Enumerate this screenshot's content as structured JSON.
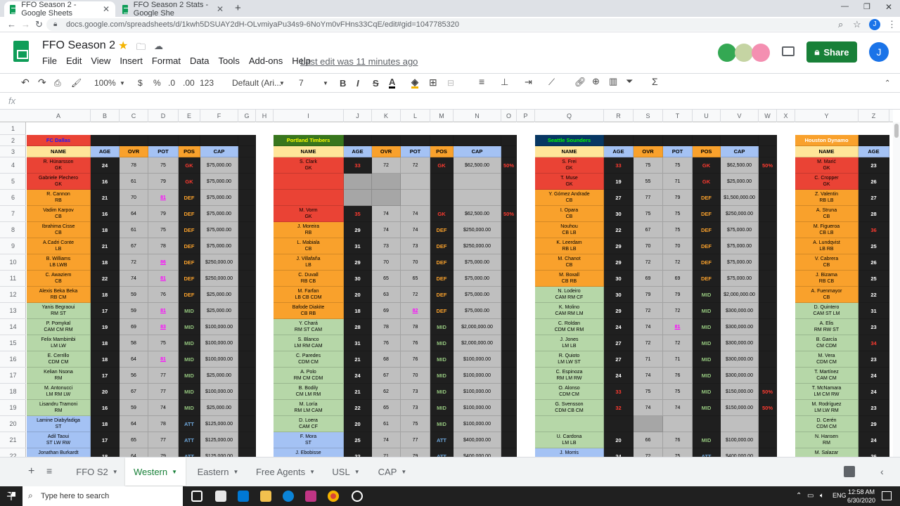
{
  "browser": {
    "tabs": [
      {
        "title": "FFO Season 2 - Google Sheets"
      },
      {
        "title": "FFO Season 2 Stats - Google She"
      }
    ],
    "url": "docs.google.com/spreadsheets/d/1kwh5DSUAY2dH-OLvmiyaPu34s9-6NoYm0vFHns33CqE/edit#gid=1047785320",
    "user_initial": "J"
  },
  "doc": {
    "title": "FFO Season 2",
    "menu": [
      "File",
      "Edit",
      "View",
      "Insert",
      "Format",
      "Data",
      "Tools",
      "Add-ons",
      "Help"
    ],
    "last_edit": "Last edit was 11 minutes ago",
    "share_label": "Share",
    "user_initial": "J"
  },
  "toolbar": {
    "zoom": "100%",
    "currency": "$",
    "percent": "%",
    "dec_less": ".0",
    "dec_more": ".00",
    "format_more": "123",
    "font": "Default (Ari...",
    "font_size": "7",
    "fx": "fx"
  },
  "columns": [
    "A",
    "B",
    "C",
    "D",
    "E",
    "F",
    "G",
    "H",
    "I",
    "J",
    "K",
    "L",
    "M",
    "N",
    "O",
    "P",
    "Q",
    "R",
    "S",
    "T",
    "U",
    "V",
    "W",
    "X",
    "Y",
    "Z"
  ],
  "rows": [
    "1",
    "2",
    "3",
    "4",
    "5",
    "6",
    "7",
    "8",
    "9",
    "10",
    "11",
    "12",
    "13",
    "14",
    "15",
    "16",
    "17",
    "18",
    "19",
    "20",
    "21",
    "22"
  ],
  "teams": [
    {
      "name": "FC Dallas",
      "color": "#ea4335",
      "name_color": "#1a1aff",
      "headers": [
        "NAME",
        "AGE",
        "OVR",
        "POT",
        "POS",
        "CAP"
      ],
      "players": [
        {
          "name": "R. Hünarsson",
          "pos2": "GK",
          "age": "24",
          "ovr": "78",
          "pot": "75",
          "pos": "GK",
          "cap": "$75,000.00",
          "bg": "#ea4335"
        },
        {
          "name": "Gabriele Plechero",
          "pos2": "GK",
          "age": "16",
          "ovr": "61",
          "pot": "79",
          "pos": "GK",
          "cap": "$75,000.00",
          "bg": "#ea4335"
        },
        {
          "name": "R. Cannon",
          "pos2": "RB",
          "age": "21",
          "ovr": "70",
          "pot": "81",
          "pos": "DEF",
          "cap": "$75,000.00",
          "bg": "#f9a12c",
          "potx": true
        },
        {
          "name": "Vadim Karpov",
          "pos2": "CB",
          "age": "16",
          "ovr": "64",
          "pot": "79",
          "pos": "DEF",
          "cap": "$75,000.00",
          "bg": "#f9a12c"
        },
        {
          "name": "Ibrahima Cisse",
          "pos2": "CB",
          "age": "18",
          "ovr": "61",
          "pot": "75",
          "pos": "DEF",
          "cap": "$75,000.00",
          "bg": "#f9a12c"
        },
        {
          "name": "A.Cadri Conte",
          "pos2": "LB",
          "age": "21",
          "ovr": "67",
          "pot": "78",
          "pos": "DEF",
          "cap": "$75,000.00",
          "bg": "#f9a12c"
        },
        {
          "name": "B. Williams",
          "pos2": "LB LWB",
          "age": "18",
          "ovr": "72",
          "pot": "86",
          "pos": "DEF",
          "cap": "$250,000.00",
          "bg": "#f9a12c",
          "potx": true
        },
        {
          "name": "C. Awaziem",
          "pos2": "CB",
          "age": "22",
          "ovr": "74",
          "pot": "81",
          "pos": "DEF",
          "cap": "$250,000.00",
          "bg": "#f9a12c",
          "potx": true
        },
        {
          "name": "Alexis Beka Beka",
          "pos2": "RB CM",
          "age": "18",
          "ovr": "59",
          "pot": "76",
          "pos": "DEF",
          "cap": "$25,000.00",
          "bg": "#f9a12c"
        },
        {
          "name": "Yanis Begraoui",
          "pos2": "RM ST",
          "age": "17",
          "ovr": "59",
          "pot": "81",
          "pos": "MID",
          "cap": "$25,000.00",
          "bg": "#b6d7a8",
          "potx": true
        },
        {
          "name": "P. Pomykal",
          "pos2": "CAM CM RM",
          "age": "19",
          "ovr": "69",
          "pot": "83",
          "pos": "MID",
          "cap": "$100,000.00",
          "bg": "#b6d7a8",
          "potx": true
        },
        {
          "name": "Felix Mambimbi",
          "pos2": "LM LW",
          "age": "18",
          "ovr": "58",
          "pot": "75",
          "pos": "MID",
          "cap": "$100,000.00",
          "bg": "#b6d7a8"
        },
        {
          "name": "E. Cerrillo",
          "pos2": "CDM CM",
          "age": "18",
          "ovr": "64",
          "pot": "81",
          "pos": "MID",
          "cap": "$100,000.00",
          "bg": "#b6d7a8",
          "potx": true
        },
        {
          "name": "Kelian Nsona",
          "pos2": "RM",
          "age": "17",
          "ovr": "56",
          "pot": "77",
          "pos": "MID",
          "cap": "$25,000.00",
          "bg": "#b6d7a8"
        },
        {
          "name": "M. Antonucci",
          "pos2": "LM RM LW",
          "age": "20",
          "ovr": "67",
          "pot": "77",
          "pos": "MID",
          "cap": "$100,000.00",
          "bg": "#b6d7a8"
        },
        {
          "name": "Lisandru Tramoni",
          "pos2": "RM",
          "age": "16",
          "ovr": "59",
          "pot": "74",
          "pos": "MID",
          "cap": "$25,000.00",
          "bg": "#b6d7a8"
        },
        {
          "name": "Lamine Diabyfadiga",
          "pos2": "ST",
          "age": "18",
          "ovr": "64",
          "pot": "78",
          "pos": "ATT",
          "cap": "$125,000.00",
          "bg": "#a4c2f4"
        },
        {
          "name": "Adil Taoui",
          "pos2": "ST LW RW",
          "age": "17",
          "ovr": "65",
          "pot": "77",
          "pos": "ATT",
          "cap": "$125,000.00",
          "bg": "#a4c2f4"
        },
        {
          "name": "Jonathan Burkardt",
          "pos2": "ST LW",
          "age": "18",
          "ovr": "64",
          "pot": "79",
          "pos": "ATT",
          "cap": "$125,000.00",
          "bg": "#a4c2f4"
        }
      ]
    },
    {
      "name": "Portland Timbers",
      "color": "#38761d",
      "name_color": "#ffff00",
      "headers": [
        "NAME",
        "AGE",
        "OVR",
        "POT",
        "POS",
        "CAP"
      ],
      "players": [
        {
          "name": "S. Clark",
          "pos2": "GK",
          "age": "33",
          "ovr": "72",
          "pot": "72",
          "pos": "GK",
          "cap": "$62,500.00",
          "bg": "#ea4335",
          "ageold": true,
          "pct": "50%"
        },
        {
          "name": "",
          "pos2": "",
          "age": "",
          "ovr": "",
          "pot": "",
          "pos": "",
          "cap": "",
          "bg": "#ea4335"
        },
        {
          "name": "",
          "pos2": "",
          "age": "",
          "ovr": "",
          "pot": "",
          "pos": "",
          "cap": "",
          "bg": "#ea4335"
        },
        {
          "name": "M. Vorm",
          "pos2": "GK",
          "age": "35",
          "ovr": "74",
          "pot": "74",
          "pos": "GK",
          "cap": "$62,500.00",
          "bg": "#ea4335",
          "ageold": true,
          "pct": "50%"
        },
        {
          "name": "J. Moreira",
          "pos2": "RB",
          "age": "29",
          "ovr": "74",
          "pot": "74",
          "pos": "DEF",
          "cap": "$250,000.00",
          "bg": "#f9a12c"
        },
        {
          "name": "L. Mabiala",
          "pos2": "CB",
          "age": "31",
          "ovr": "73",
          "pot": "73",
          "pos": "DEF",
          "cap": "$250,000.00",
          "bg": "#f9a12c"
        },
        {
          "name": "J. Villafaña",
          "pos2": "LB",
          "age": "29",
          "ovr": "70",
          "pot": "70",
          "pos": "DEF",
          "cap": "$75,000.00",
          "bg": "#f9a12c"
        },
        {
          "name": "C. Duvall",
          "pos2": "RB CB",
          "age": "30",
          "ovr": "65",
          "pot": "65",
          "pos": "DEF",
          "cap": "$75,000.00",
          "bg": "#f9a12c"
        },
        {
          "name": "M. Farfan",
          "pos2": "LB CB CDM",
          "age": "20",
          "ovr": "63",
          "pot": "72",
          "pos": "DEF",
          "cap": "$75,000.00",
          "bg": "#f9a12c"
        },
        {
          "name": "Bafode Diakite",
          "pos2": "CB RB",
          "age": "18",
          "ovr": "69",
          "pot": "82",
          "pos": "DEF",
          "cap": "$75,000.00",
          "bg": "#f9a12c",
          "potx": true
        },
        {
          "name": "Y. Chará",
          "pos2": "RM ST CAM",
          "age": "28",
          "ovr": "78",
          "pot": "78",
          "pos": "MID",
          "cap": "$2,000,000.00",
          "bg": "#b6d7a8"
        },
        {
          "name": "S. Blanco",
          "pos2": "LM RM CAM",
          "age": "31",
          "ovr": "76",
          "pot": "76",
          "pos": "MID",
          "cap": "$2,000,000.00",
          "bg": "#b6d7a8"
        },
        {
          "name": "C. Paredes",
          "pos2": "CDM CM",
          "age": "21",
          "ovr": "68",
          "pot": "76",
          "pos": "MID",
          "cap": "$100,000.00",
          "bg": "#b6d7a8"
        },
        {
          "name": "A. Polo",
          "pos2": "RM CM CDM",
          "age": "24",
          "ovr": "67",
          "pot": "70",
          "pos": "MID",
          "cap": "$100,000.00",
          "bg": "#b6d7a8"
        },
        {
          "name": "B. Bodily",
          "pos2": "CM LM RM",
          "age": "21",
          "ovr": "62",
          "pot": "73",
          "pos": "MID",
          "cap": "$100,000.00",
          "bg": "#b6d7a8"
        },
        {
          "name": "M. Loría",
          "pos2": "RM LM CAM",
          "age": "22",
          "ovr": "65",
          "pot": "73",
          "pos": "MID",
          "cap": "$100,000.00",
          "bg": "#b6d7a8"
        },
        {
          "name": "D. Loera",
          "pos2": "CAM CF",
          "age": "20",
          "ovr": "61",
          "pot": "75",
          "pos": "MID",
          "cap": "$100,000.00",
          "bg": "#b6d7a8"
        },
        {
          "name": "F. Mora",
          "pos2": "ST",
          "age": "25",
          "ovr": "74",
          "pot": "77",
          "pos": "ATT",
          "cap": "$400,000.00",
          "bg": "#a4c2f4"
        },
        {
          "name": "J. Ebobisse",
          "pos2": "ST LW RW",
          "age": "22",
          "ovr": "71",
          "pot": "79",
          "pos": "ATT",
          "cap": "$400,000.00",
          "bg": "#a4c2f4"
        }
      ]
    },
    {
      "name": "Seattle Sounders",
      "color": "#073763",
      "name_color": "#00ff00",
      "headers": [
        "NAME",
        "AGE",
        "OVR",
        "POT",
        "POS",
        "CAP"
      ],
      "players": [
        {
          "name": "S. Frei",
          "pos2": "GK",
          "age": "33",
          "ovr": "75",
          "pot": "75",
          "pos": "GK",
          "cap": "$62,500.00",
          "bg": "#ea4335",
          "ageold": true,
          "pct": "50%"
        },
        {
          "name": "T. Muse",
          "pos2": "GK",
          "age": "19",
          "ovr": "55",
          "pot": "71",
          "pos": "GK",
          "cap": "$25,000.00",
          "bg": "#ea4335"
        },
        {
          "name": "Y. Gómez Andrade",
          "pos2": "CB",
          "age": "27",
          "ovr": "77",
          "pot": "79",
          "pos": "DEF",
          "cap": "$1,500,000.00",
          "bg": "#f9a12c"
        },
        {
          "name": "I. Opara",
          "pos2": "CB",
          "age": "30",
          "ovr": "75",
          "pot": "75",
          "pos": "DEF",
          "cap": "$250,000.00",
          "bg": "#f9a12c"
        },
        {
          "name": "Nouhou",
          "pos2": "CB LB",
          "age": "22",
          "ovr": "67",
          "pot": "75",
          "pos": "DEF",
          "cap": "$75,000.00",
          "bg": "#f9a12c"
        },
        {
          "name": "K. Leerdam",
          "pos2": "RB LB",
          "age": "29",
          "ovr": "70",
          "pot": "70",
          "pos": "DEF",
          "cap": "$75,000.00",
          "bg": "#f9a12c"
        },
        {
          "name": "M. Chanot",
          "pos2": "CB",
          "age": "29",
          "ovr": "72",
          "pot": "72",
          "pos": "DEF",
          "cap": "$75,000.00",
          "bg": "#f9a12c"
        },
        {
          "name": "M. Boxall",
          "pos2": "CB RB",
          "age": "30",
          "ovr": "69",
          "pot": "69",
          "pos": "DEF",
          "cap": "$75,000.00",
          "bg": "#f9a12c"
        },
        {
          "name": "N. Lodeiro",
          "pos2": "CAM RM CF",
          "age": "30",
          "ovr": "79",
          "pot": "79",
          "pos": "MID",
          "cap": "$2,000,000.00",
          "bg": "#b6d7a8"
        },
        {
          "name": "K. Molino",
          "pos2": "CAM RM LM",
          "age": "29",
          "ovr": "72",
          "pot": "72",
          "pos": "MID",
          "cap": "$300,000.00",
          "bg": "#b6d7a8"
        },
        {
          "name": "C. Roldan",
          "pos2": "CDM CM RM",
          "age": "24",
          "ovr": "74",
          "pot": "81",
          "pos": "MID",
          "cap": "$300,000.00",
          "bg": "#b6d7a8",
          "potx": true
        },
        {
          "name": "J. Jones",
          "pos2": "LM LB",
          "age": "27",
          "ovr": "72",
          "pot": "72",
          "pos": "MID",
          "cap": "$300,000.00",
          "bg": "#b6d7a8"
        },
        {
          "name": "R. Quioto",
          "pos2": "LM LW ST",
          "age": "27",
          "ovr": "71",
          "pot": "71",
          "pos": "MID",
          "cap": "$300,000.00",
          "bg": "#b6d7a8"
        },
        {
          "name": "C. Espinoza",
          "pos2": "RM LM RW",
          "age": "24",
          "ovr": "74",
          "pot": "76",
          "pos": "MID",
          "cap": "$300,000.00",
          "bg": "#b6d7a8"
        },
        {
          "name": "O. Alonso",
          "pos2": "CDM CM",
          "age": "33",
          "ovr": "75",
          "pot": "75",
          "pos": "MID",
          "cap": "$150,000.00",
          "bg": "#b6d7a8",
          "ageold": true,
          "pct": "50%"
        },
        {
          "name": "G. Svensson",
          "pos2": "CDM CB CM",
          "age": "32",
          "ovr": "74",
          "pot": "74",
          "pos": "MID",
          "cap": "$150,000.00",
          "bg": "#b6d7a8",
          "ageold": true,
          "pct": "50%"
        },
        {
          "name": "",
          "pos2": "",
          "age": "",
          "ovr": "",
          "pot": "",
          "pos": "",
          "cap": "",
          "bg": "#b6d7a8"
        },
        {
          "name": "U. Cardona",
          "pos2": "LM LB",
          "age": "20",
          "ovr": "66",
          "pot": "76",
          "pos": "MID",
          "cap": "$100,000.00",
          "bg": "#b6d7a8"
        },
        {
          "name": "J. Morris",
          "pos2": "RW LW ST",
          "age": "24",
          "ovr": "72",
          "pot": "75",
          "pos": "ATT",
          "cap": "$400,000.00",
          "bg": "#a4c2f4"
        }
      ]
    },
    {
      "name": "Houston Dynamo",
      "color": "#f9a12c",
      "name_color": "#ffffff",
      "headers": [
        "NAME",
        "AGE"
      ],
      "players": [
        {
          "name": "M. Marić",
          "pos2": "GK",
          "age": "23",
          "bg": "#ea4335"
        },
        {
          "name": "C. Cropper",
          "pos2": "GK",
          "age": "26",
          "bg": "#ea4335"
        },
        {
          "name": "Z. Valentin",
          "pos2": "RB LB",
          "age": "27",
          "bg": "#f9a12c"
        },
        {
          "name": "A. Struna",
          "pos2": "CB",
          "age": "28",
          "bg": "#f9a12c"
        },
        {
          "name": "M. Figueroa",
          "pos2": "CB LB",
          "age": "36",
          "bg": "#f9a12c",
          "ageold": true
        },
        {
          "name": "A. Lundqvist",
          "pos2": "LB RB",
          "age": "25",
          "bg": "#f9a12c"
        },
        {
          "name": "V. Cabrera",
          "pos2": "CB",
          "age": "26",
          "bg": "#f9a12c"
        },
        {
          "name": "J. Bizama",
          "pos2": "RB CB",
          "age": "25",
          "bg": "#f9a12c"
        },
        {
          "name": "A. Fuenmayor",
          "pos2": "CB",
          "age": "22",
          "bg": "#f9a12c"
        },
        {
          "name": "D. Quintero",
          "pos2": "CAM ST LM",
          "age": "31",
          "bg": "#b6d7a8"
        },
        {
          "name": "A. Elis",
          "pos2": "RM RW ST",
          "age": "23",
          "bg": "#b6d7a8"
        },
        {
          "name": "B. García",
          "pos2": "CM CDM",
          "age": "34",
          "bg": "#b6d7a8",
          "ageold": true
        },
        {
          "name": "M. Vera",
          "pos2": "CDM CM",
          "age": "23",
          "bg": "#b6d7a8"
        },
        {
          "name": "T. Martínez",
          "pos2": "CAM CM",
          "age": "24",
          "bg": "#b6d7a8"
        },
        {
          "name": "T. McNamara",
          "pos2": "LM CM RW",
          "age": "24",
          "bg": "#b6d7a8"
        },
        {
          "name": "M. Rodríguez",
          "pos2": "LM LW RM",
          "age": "23",
          "bg": "#b6d7a8"
        },
        {
          "name": "D. Cerén",
          "pos2": "CDM CM",
          "age": "29",
          "bg": "#b6d7a8"
        },
        {
          "name": "N. Hansen",
          "pos2": "RM",
          "age": "24",
          "bg": "#b6d7a8"
        },
        {
          "name": "M. Salazar",
          "pos2": "RM RW CM",
          "age": "26",
          "bg": "#b6d7a8"
        }
      ]
    }
  ],
  "sheet_tabs": [
    {
      "label": "FFO S2"
    },
    {
      "label": "Western",
      "active": true
    },
    {
      "label": "Eastern"
    },
    {
      "label": "Free Agents"
    },
    {
      "label": "USL"
    },
    {
      "label": "CAP"
    }
  ],
  "taskbar": {
    "search_placeholder": "Type here to search",
    "time": "12:58 AM",
    "date": "6/30/2020",
    "lang": "ENG"
  }
}
